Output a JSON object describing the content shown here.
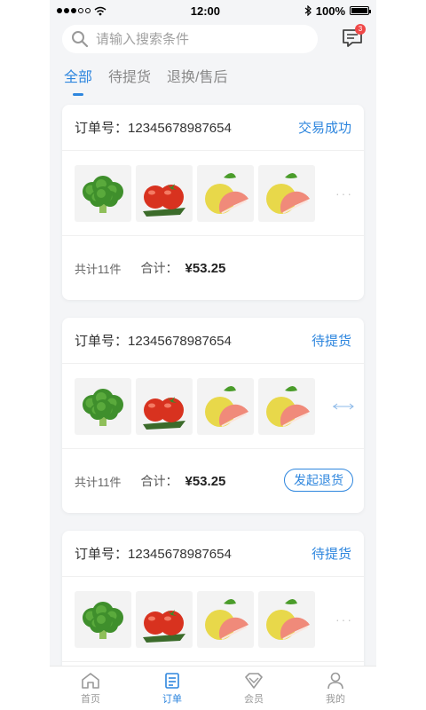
{
  "status_bar": {
    "time": "12:00",
    "battery": "100%",
    "battery_level": 1.0
  },
  "search": {
    "placeholder": "请输入搜索条件"
  },
  "messages": {
    "badge": "3"
  },
  "tabs": [
    {
      "label": "全部",
      "active": true
    },
    {
      "label": "待提货",
      "active": false
    },
    {
      "label": "退换/售后",
      "active": false
    }
  ],
  "orders": [
    {
      "order_label": "订单号：",
      "order_no": "12345678987654",
      "status": "交易成功",
      "count": "共计11件",
      "total_label": "合计：",
      "total": "¥53.25",
      "action": ""
    },
    {
      "order_label": "订单号：",
      "order_no": "12345678987654",
      "status": "待提货",
      "count": "共计11件",
      "total_label": "合计：",
      "total": "¥53.25",
      "action": "发起退货"
    },
    {
      "order_label": "订单号：",
      "order_no": "12345678987654",
      "status": "待提货",
      "count": "",
      "total_label": "",
      "total": "",
      "action": ""
    }
  ],
  "products": [
    "broccoli",
    "tomato",
    "pomelo",
    "pomelo"
  ],
  "more": "···",
  "nav": [
    {
      "label": "首页",
      "icon": "home-icon",
      "active": false
    },
    {
      "label": "订单",
      "icon": "order-icon",
      "active": true
    },
    {
      "label": "会员",
      "icon": "member-icon",
      "active": false
    },
    {
      "label": "我的",
      "icon": "profile-icon",
      "active": false
    }
  ],
  "colors": {
    "accent": "#2e86de",
    "badge": "#f04848",
    "background": "#f4f5f7"
  }
}
